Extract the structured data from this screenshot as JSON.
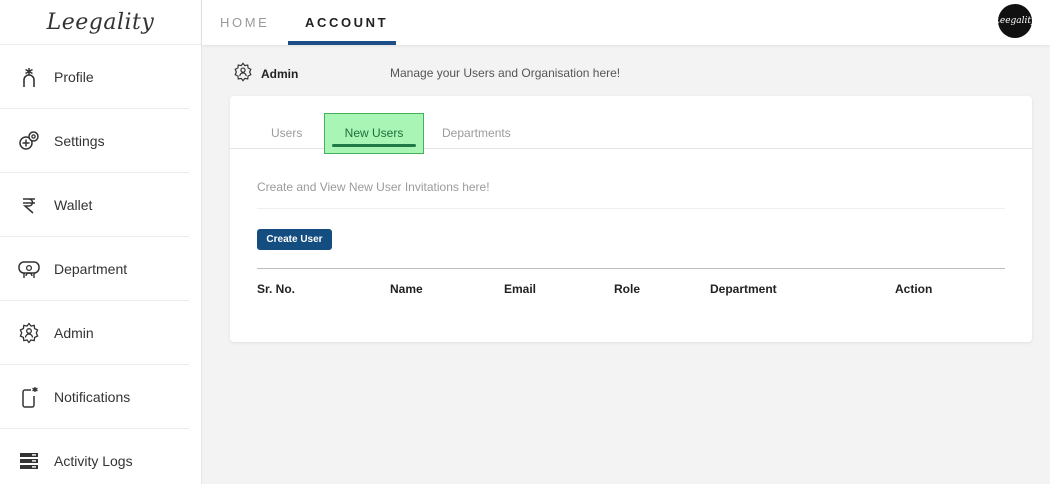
{
  "brand": {
    "logo_text": "Leegality",
    "avatar_text": "Leegality"
  },
  "topnav": {
    "home": "HOME",
    "account": "ACCOUNT"
  },
  "sidebar": {
    "items": [
      {
        "label": "Profile",
        "icon": "profile-icon"
      },
      {
        "label": "Settings",
        "icon": "settings-icon"
      },
      {
        "label": "Wallet",
        "icon": "rupee-icon"
      },
      {
        "label": "Department",
        "icon": "department-icon"
      },
      {
        "label": "Admin",
        "icon": "admin-icon"
      },
      {
        "label": "Notifications",
        "icon": "notifications-icon"
      },
      {
        "label": "Activity Logs",
        "icon": "activity-logs-icon"
      }
    ]
  },
  "header": {
    "title": "Admin",
    "subtitle": "Manage your Users and Organisation here!"
  },
  "card": {
    "tabs": [
      {
        "label": "Users"
      },
      {
        "label": "New Users",
        "active": true
      },
      {
        "label": "Departments"
      }
    ],
    "description": "Create and View New User Invitations here!",
    "create_button": "Create User",
    "table": {
      "columns": [
        "Sr. No.",
        "Name",
        "Email",
        "Role",
        "Department",
        "Action"
      ],
      "rows": []
    }
  },
  "colors": {
    "accent": "#1d4f86",
    "button": "#144d80",
    "active_tab_bg": "#a9f5b6",
    "active_tab_border": "#45b05a"
  }
}
